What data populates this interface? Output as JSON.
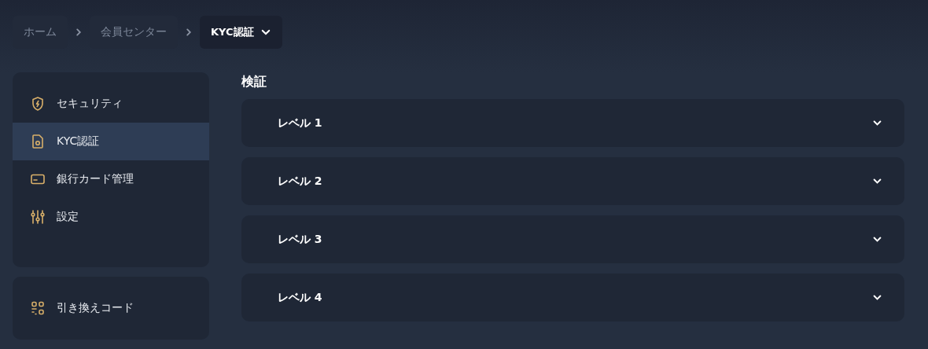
{
  "breadcrumbs": [
    {
      "label": "ホーム",
      "selected": false
    },
    {
      "label": "会員センター",
      "selected": false
    },
    {
      "label": "KYC認証",
      "selected": true
    }
  ],
  "sidebar": {
    "groups": [
      {
        "items": [
          {
            "label": "セキュリティ",
            "selected": false
          },
          {
            "label": "KYC認証",
            "selected": true
          },
          {
            "label": "銀行カード管理",
            "selected": false
          },
          {
            "label": "設定",
            "selected": false
          }
        ]
      },
      {
        "items": [
          {
            "label": "引き換えコード",
            "selected": false
          }
        ]
      }
    ]
  },
  "main": {
    "title": "検証",
    "sections": [
      {
        "label": "レベル 1",
        "expanded": false
      },
      {
        "label": "レベル 2",
        "expanded": false
      },
      {
        "label": "レベル 3",
        "expanded": false
      },
      {
        "label": "レベル 4",
        "expanded": false
      }
    ]
  }
}
